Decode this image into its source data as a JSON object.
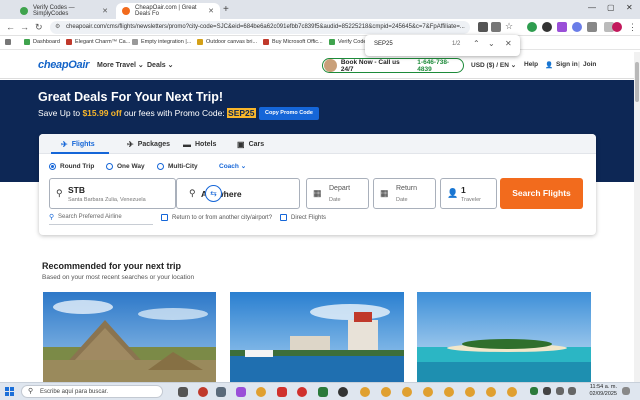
{
  "browser": {
    "tabs": [
      {
        "title": "Verify Codes — SimplyCodes",
        "active": false
      },
      {
        "title": "CheapOair.com | Great Deals Fo",
        "active": true
      }
    ],
    "url": "cheapoair.com/cms/flights/newsletters/promo?city-code=SJC&eid=684be6a62c091efbb7c839f5&audid=85225218&cmpid=245645&c=7&FpAffiliate=...",
    "bookmarks": [
      "Dashboard",
      "Elegant Charm™ Ca...",
      "Empty integration |...",
      "Outdoor canvas bri...",
      "Buy Microsoft Offic...",
      "Verify Codes"
    ],
    "find": {
      "query": "SEP25",
      "count": "1/2"
    }
  },
  "site": {
    "logo": "cheapOair",
    "nav": [
      "More Travel",
      "Deals"
    ],
    "phone_label": "Book Now - Call us 24/7",
    "phone": "1-646-738-4839",
    "currency": "USD ($) / EN",
    "help": "Help",
    "signin": "Sign in",
    "join": "Join"
  },
  "hero": {
    "title": "Great Deals For Your Next Trip!",
    "sub_prefix": "Save Up to",
    "amount": "$15.99 off",
    "sub_mid": "our fees with Promo Code:",
    "code": "SEP25",
    "copy_button": "Copy Promo Code"
  },
  "search": {
    "tabs": [
      "Flights",
      "Packages",
      "Hotels",
      "Cars"
    ],
    "trip_types": [
      "Round Trip",
      "One Way",
      "Multi-City"
    ],
    "selected_trip": "Round Trip",
    "cabin": "Coach",
    "from_code": "STB",
    "from_city": "Santa Barbara Zulia, Venezuela",
    "to": "Anywhere",
    "depart_label": "Depart",
    "depart_value": "Date",
    "return_label": "Return",
    "return_value": "Date",
    "travelers": "1",
    "travelers_label": "Traveler",
    "search_button": "Search Flights",
    "airline_placeholder": "Search Preferred Airline",
    "check_return": "Return to or from another city/airport?",
    "check_direct": "Direct Flights"
  },
  "recommended": {
    "title": "Recommended for your next trip",
    "subtitle": "Based on your most recent searches or your location"
  },
  "taskbar": {
    "search_placeholder": "Escribe aquí para buscar.",
    "time": "11:54 a. m.",
    "date": "02/09/2025"
  },
  "colors": {
    "brand_blue": "#1566d8",
    "hero_navy": "#0d2755",
    "orange": "#f26b1d",
    "promo_yellow": "#f8b62b"
  }
}
